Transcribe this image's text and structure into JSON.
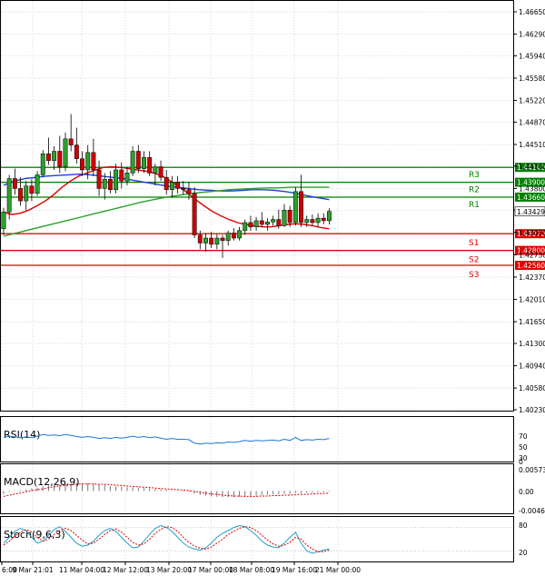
{
  "chart_data": {
    "type": "candlestick",
    "price_axis": {
      "ticks": [
        "1.46650",
        "1.46290",
        "1.45940",
        "1.45580",
        "1.45220",
        "1.44870",
        "1.44510",
        "1.44160",
        "1.43800",
        "1.43450",
        "1.43090",
        "1.42730",
        "1.42370",
        "1.42010",
        "1.41650",
        "1.41300",
        "1.40940",
        "1.40580",
        "1.40230"
      ],
      "range": [
        1.4023,
        1.4665
      ]
    },
    "time_axis": {
      "labels": [
        "6:00",
        "9 Mar 21:01",
        "11 Mar 04:00",
        "12 Mar 12:00",
        "13 Mar 20:00",
        "17 Mar 00:00",
        "18 Mar 08:00",
        "19 Mar 16:00",
        "21 Mar 00:00"
      ]
    },
    "current_price": {
      "label": "1.43429",
      "value": 1.43429
    },
    "levels": [
      {
        "name": "R3",
        "value": 1.4414,
        "label": "1.44140",
        "color": "#008000"
      },
      {
        "name": "R2",
        "value": 1.439,
        "label": "1.43900",
        "color": "#008000"
      },
      {
        "name": "R1",
        "value": 1.4366,
        "label": "1.43660",
        "color": "#008000"
      },
      {
        "name": "S1",
        "value": 1.4307,
        "label": "1.43070",
        "color": "#e00000"
      },
      {
        "name": "S2",
        "value": 1.428,
        "label": "1.42800",
        "color": "#e00000"
      },
      {
        "name": "S3",
        "value": 1.4256,
        "label": "1.42560",
        "color": "#e00000"
      }
    ],
    "candles": [
      [
        1.4315,
        1.4349,
        1.4305,
        1.4342
      ],
      [
        1.4342,
        1.4402,
        1.433,
        1.4396
      ],
      [
        1.4396,
        1.4412,
        1.437,
        1.438
      ],
      [
        1.438,
        1.4398,
        1.4352,
        1.436
      ],
      [
        1.436,
        1.4392,
        1.4345,
        1.4384
      ],
      [
        1.4384,
        1.4395,
        1.436,
        1.4372
      ],
      [
        1.4372,
        1.4408,
        1.4368,
        1.4402
      ],
      [
        1.4402,
        1.4442,
        1.4398,
        1.4436
      ],
      [
        1.4436,
        1.4462,
        1.4418,
        1.4425
      ],
      [
        1.4425,
        1.4448,
        1.441,
        1.444
      ],
      [
        1.444,
        1.4465,
        1.4405,
        1.4415
      ],
      [
        1.4415,
        1.447,
        1.4408,
        1.446
      ],
      [
        1.446,
        1.45,
        1.444,
        1.445
      ],
      [
        1.445,
        1.4478,
        1.442,
        1.4428
      ],
      [
        1.4428,
        1.444,
        1.44,
        1.441
      ],
      [
        1.441,
        1.445,
        1.4395,
        1.4438
      ],
      [
        1.4438,
        1.446,
        1.44,
        1.441
      ],
      [
        1.441,
        1.4425,
        1.4368,
        1.438
      ],
      [
        1.438,
        1.4405,
        1.4362,
        1.4395
      ],
      [
        1.4395,
        1.4408,
        1.4372,
        1.4378
      ],
      [
        1.4378,
        1.442,
        1.4372,
        1.441
      ],
      [
        1.441,
        1.4422,
        1.438,
        1.4392
      ],
      [
        1.4392,
        1.4415,
        1.4385,
        1.4405
      ],
      [
        1.4405,
        1.4448,
        1.44,
        1.444
      ],
      [
        1.444,
        1.445,
        1.4405,
        1.4412
      ],
      [
        1.4412,
        1.444,
        1.4405,
        1.443
      ],
      [
        1.443,
        1.444,
        1.44,
        1.4405
      ],
      [
        1.4405,
        1.442,
        1.4385,
        1.4415
      ],
      [
        1.4415,
        1.4425,
        1.4392,
        1.4398
      ],
      [
        1.4398,
        1.441,
        1.437,
        1.4378
      ],
      [
        1.4378,
        1.44,
        1.4365,
        1.439
      ],
      [
        1.439,
        1.44,
        1.4372,
        1.438
      ],
      [
        1.438,
        1.4392,
        1.437,
        1.4378
      ],
      [
        1.4378,
        1.439,
        1.4362,
        1.4372
      ],
      [
        1.4372,
        1.4382,
        1.43,
        1.4305
      ],
      [
        1.4305,
        1.4312,
        1.4282,
        1.4292
      ],
      [
        1.4292,
        1.4308,
        1.4278,
        1.43
      ],
      [
        1.43,
        1.431,
        1.4284,
        1.429
      ],
      [
        1.429,
        1.4306,
        1.4282,
        1.43
      ],
      [
        1.43,
        1.4305,
        1.4268,
        1.4296
      ],
      [
        1.4296,
        1.4312,
        1.4288,
        1.4308
      ],
      [
        1.4308,
        1.4316,
        1.4296,
        1.43
      ],
      [
        1.43,
        1.4318,
        1.4296,
        1.4312
      ],
      [
        1.4312,
        1.433,
        1.4305,
        1.4325
      ],
      [
        1.4325,
        1.4336,
        1.4312,
        1.4318
      ],
      [
        1.4318,
        1.4334,
        1.4312,
        1.4328
      ],
      [
        1.4328,
        1.4342,
        1.4318,
        1.4322
      ],
      [
        1.4322,
        1.4332,
        1.4312,
        1.4326
      ],
      [
        1.4326,
        1.4336,
        1.432,
        1.433
      ],
      [
        1.433,
        1.4346,
        1.4315,
        1.432
      ],
      [
        1.432,
        1.4355,
        1.4318,
        1.4345
      ],
      [
        1.4345,
        1.4352,
        1.4318,
        1.4325
      ],
      [
        1.4325,
        1.4382,
        1.432,
        1.4375
      ],
      [
        1.4375,
        1.4402,
        1.4318,
        1.4325
      ],
      [
        1.4325,
        1.4336,
        1.4318,
        1.433
      ],
      [
        1.433,
        1.4338,
        1.432,
        1.4325
      ],
      [
        1.4325,
        1.434,
        1.4318,
        1.4332
      ],
      [
        1.4332,
        1.434,
        1.4322,
        1.4328
      ],
      [
        1.4328,
        1.4348,
        1.4322,
        1.4343
      ]
    ],
    "moving_averages": [
      {
        "color": "#e00000",
        "points": [
          1.4342,
          1.4338,
          1.434,
          1.4345,
          1.4352,
          1.436,
          1.437,
          1.4382,
          1.4392,
          1.44,
          1.4405,
          1.441,
          1.4414,
          1.4415,
          1.4414,
          1.4412,
          1.441,
          1.4408,
          1.4405,
          1.44,
          1.4392,
          1.4383,
          1.4373,
          1.4362,
          1.4352,
          1.4343,
          1.4336,
          1.433,
          1.4325,
          1.4322,
          1.432,
          1.4318,
          1.4318,
          1.432,
          1.4322,
          1.4323,
          1.4322,
          1.432,
          1.4317,
          1.4315
        ]
      },
      {
        "color": "#2040d0",
        "points": [
          1.4385,
          1.4392,
          1.4396,
          1.4398,
          1.44,
          1.4401,
          1.4402,
          1.4403,
          1.4402,
          1.44,
          1.4398,
          1.4396,
          1.4393,
          1.439,
          1.4387,
          1.4384,
          1.4382,
          1.438,
          1.4378,
          1.4377,
          1.4376,
          1.4376,
          1.4377,
          1.4378,
          1.4378,
          1.4377,
          1.4375,
          1.4372,
          1.4368,
          1.4365,
          1.4362
        ]
      },
      {
        "color": "#2ca02c",
        "points": [
          1.4303,
          1.4308,
          1.4313,
          1.4318,
          1.4323,
          1.4328,
          1.4333,
          1.4338,
          1.4343,
          1.4348,
          1.4353,
          1.4358,
          1.4362,
          1.4366,
          1.4369,
          1.4372,
          1.4374,
          1.4376,
          1.4378,
          1.4379,
          1.438,
          1.4381,
          1.4381,
          1.4382,
          1.4382,
          1.4382,
          1.4382
        ]
      }
    ],
    "indicators": [
      {
        "name": "RSI(14)",
        "ticks": [
          "70",
          "50",
          "30",
          "0"
        ],
        "range": [
          0,
          100
        ],
        "values": [
          55,
          58,
          56,
          54,
          56,
          54,
          58,
          62,
          60,
          61,
          59,
          62,
          60,
          57,
          55,
          57,
          55,
          52,
          54,
          52,
          55,
          53,
          55,
          58,
          55,
          57,
          54,
          56,
          53,
          50,
          52,
          50,
          50,
          49,
          40,
          38,
          40,
          39,
          41,
          40,
          43,
          42,
          44,
          47,
          45,
          47,
          46,
          47,
          48,
          46,
          50,
          47,
          55,
          47,
          49,
          48,
          50,
          49,
          52
        ]
      },
      {
        "name": "MACD(12,26,9)",
        "ticks": [
          "0.005733",
          "0.00",
          "-0.00468"
        ],
        "range": [
          -0.00468,
          0.005733
        ],
        "values": [
          -0.0007,
          -0.0002,
          0.0001,
          0.0002,
          0.0004,
          0.0006,
          0.0008,
          0.0011,
          0.0013,
          0.0015,
          0.0016,
          0.0018,
          0.0019,
          0.0019,
          0.0018,
          0.0018,
          0.0017,
          0.0015,
          0.0014,
          0.0012,
          0.0011,
          0.001,
          0.0009,
          0.0009,
          0.0008,
          0.0007,
          0.0006,
          0.0005,
          0.0004,
          0.0003,
          0.0001,
          0.0,
          -0.0001,
          -0.0002,
          -0.0006,
          -0.0009,
          -0.0011,
          -0.0013,
          -0.0014,
          -0.0015,
          -0.0015,
          -0.0015,
          -0.0014,
          -0.0013,
          -0.0012,
          -0.0011,
          -0.001,
          -0.0009,
          -0.0008,
          -0.0008,
          -0.0007,
          -0.0007,
          -0.0005,
          -0.0005,
          -0.0004,
          -0.0004,
          -0.0003,
          -0.0003,
          -0.0002
        ],
        "signal": [
          -0.0013,
          -0.001,
          -0.0007,
          -0.0005,
          -0.0002,
          0.0001,
          0.0003,
          0.0005,
          0.0008,
          0.001,
          0.0012,
          0.0014,
          0.0015,
          0.0016,
          0.0017,
          0.0017,
          0.0017,
          0.0016,
          0.0016,
          0.0015,
          0.0014,
          0.0013,
          0.0012,
          0.0011,
          0.001,
          0.0009,
          0.0008,
          0.0007,
          0.0006,
          0.0005,
          0.0004,
          0.0003,
          0.0002,
          0.0001,
          -0.0001,
          -0.0003,
          -0.0005,
          -0.0007,
          -0.0008,
          -0.001,
          -0.0011,
          -0.0012,
          -0.0012,
          -0.0013,
          -0.0013,
          -0.0013,
          -0.0012,
          -0.0012,
          -0.0011,
          -0.0011,
          -0.001,
          -0.001,
          -0.0009,
          -0.0008,
          -0.0008,
          -0.0007,
          -0.0006,
          -0.0006,
          -0.0005
        ]
      },
      {
        "name": "Stoch(9,6,3)",
        "ticks": [
          "80",
          "20"
        ],
        "range": [
          0,
          100
        ],
        "k": [
          40,
          55,
          70,
          78,
          72,
          55,
          40,
          45,
          60,
          75,
          82,
          70,
          55,
          40,
          32,
          35,
          45,
          60,
          72,
          78,
          70,
          55,
          40,
          28,
          30,
          45,
          62,
          78,
          85,
          80,
          70,
          55,
          40,
          30,
          25,
          22,
          28,
          40,
          55,
          65,
          72,
          80,
          85,
          82,
          72,
          60,
          45,
          35,
          30,
          28,
          40,
          55,
          68,
          40,
          20,
          14,
          18,
          22,
          25
        ],
        "d": [
          35,
          45,
          58,
          68,
          75,
          68,
          55,
          45,
          50,
          62,
          72,
          78,
          72,
          60,
          48,
          38,
          40,
          50,
          62,
          72,
          76,
          68,
          55,
          42,
          35,
          38,
          50,
          65,
          75,
          82,
          80,
          70,
          55,
          42,
          32,
          27,
          25,
          30,
          40,
          50,
          62,
          70,
          78,
          82,
          80,
          72,
          60,
          48,
          38,
          32,
          35,
          42,
          55,
          50,
          35,
          25,
          18,
          18,
          22
        ]
      }
    ]
  }
}
